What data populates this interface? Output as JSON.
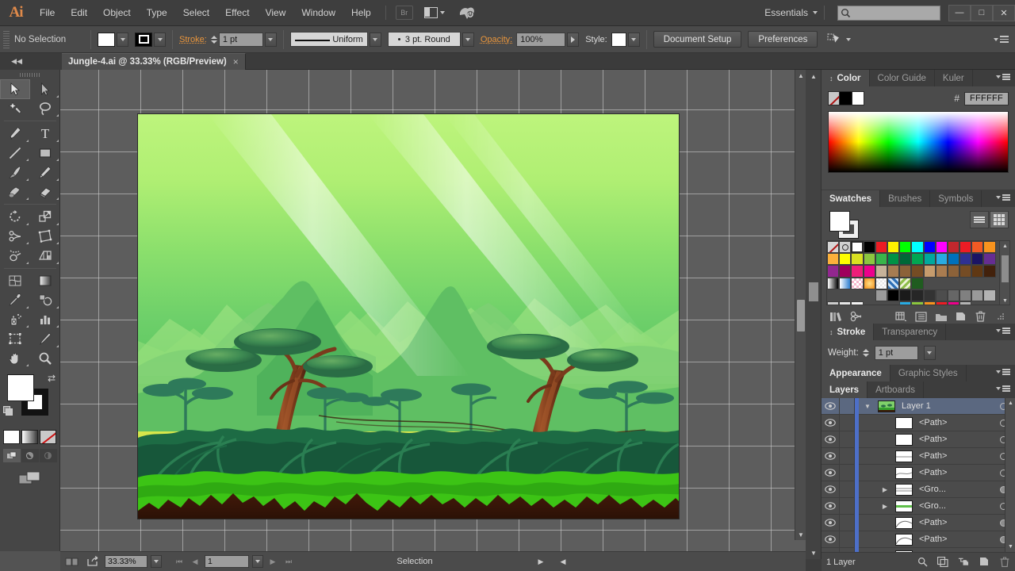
{
  "app": {
    "logo": "Ai",
    "menus": [
      "File",
      "Edit",
      "Object",
      "Type",
      "Select",
      "Effect",
      "View",
      "Window",
      "Help"
    ],
    "bridge_label": "Br",
    "workspace": "Essentials",
    "search_placeholder": "",
    "search_value": "",
    "window_buttons": {
      "minimize": "—",
      "maximize": "□",
      "close": "✕"
    }
  },
  "control_bar": {
    "selection_label": "No Selection",
    "fill_color": "#FFFFFF",
    "stroke_color": "#000000",
    "stroke_label": "Stroke:",
    "stroke_weight": "1 pt",
    "profile_label": "Uniform",
    "brush_label": "3 pt. Round",
    "opacity_label": "Opacity:",
    "opacity_value": "100%",
    "style_label": "Style:",
    "document_setup": "Document Setup",
    "preferences": "Preferences"
  },
  "document": {
    "tab_title": "Jungle-4.ai @ 33.33% (RGB/Preview)",
    "close_glyph": "×"
  },
  "toolbox": {
    "tools": [
      {
        "name": "selection-tool",
        "active": true
      },
      {
        "name": "direct-selection-tool",
        "active": false
      },
      {
        "name": "magic-wand-tool",
        "active": false
      },
      {
        "name": "lasso-tool",
        "active": false
      },
      {
        "name": "pen-tool",
        "active": false
      },
      {
        "name": "type-tool",
        "active": false
      },
      {
        "name": "line-segment-tool",
        "active": false
      },
      {
        "name": "rectangle-tool",
        "active": false
      },
      {
        "name": "paintbrush-tool",
        "active": false
      },
      {
        "name": "pencil-tool",
        "active": false
      },
      {
        "name": "blob-brush-tool",
        "active": false
      },
      {
        "name": "eraser-tool",
        "active": false
      },
      {
        "name": "rotate-tool",
        "active": false
      },
      {
        "name": "scale-tool",
        "active": false
      },
      {
        "name": "width-tool",
        "active": false
      },
      {
        "name": "free-transform-tool",
        "active": false
      },
      {
        "name": "shape-builder-tool",
        "active": false
      },
      {
        "name": "perspective-grid-tool",
        "active": false
      },
      {
        "name": "mesh-tool",
        "active": false
      },
      {
        "name": "gradient-tool",
        "active": false
      },
      {
        "name": "eyedropper-tool",
        "active": false
      },
      {
        "name": "blend-tool",
        "active": false
      },
      {
        "name": "symbol-sprayer-tool",
        "active": false
      },
      {
        "name": "column-graph-tool",
        "active": false
      },
      {
        "name": "artboard-tool",
        "active": false
      },
      {
        "name": "slice-tool",
        "active": false
      },
      {
        "name": "hand-tool",
        "active": false
      },
      {
        "name": "zoom-tool",
        "active": false
      }
    ],
    "fill_color": "#FFFFFF",
    "stroke_color": "#FFFFFF",
    "mode_buttons": [
      "color-fill",
      "gradient-fill",
      "none-fill"
    ],
    "draw_modes": [
      "draw-normal",
      "draw-behind",
      "draw-inside"
    ],
    "screen_mode": "change-screen-mode"
  },
  "color_panel": {
    "tabs": [
      "Color",
      "Color Guide",
      "Kuler"
    ],
    "active_tab": "Color",
    "hash_label": "#",
    "hex_value": "FFFFFF"
  },
  "swatches_panel": {
    "tabs": [
      "Swatches",
      "Brushes",
      "Symbols"
    ],
    "active_tab": "Swatches",
    "fill_color": "#FFFFFF",
    "rows": [
      [
        "none",
        "#8a8a8a",
        "#ffffff",
        "#000000",
        "#ec1c24",
        "#fff200",
        "#00ff00",
        "#00ffff",
        "#0000ff",
        "#ff00ff",
        "#c1272d",
        "#ed1c24",
        "#f15a24",
        "#f7931e",
        "#fbb03b"
      ],
      [
        "#ffff00",
        "#d9e021",
        "#8cc63f",
        "#39b54a",
        "#009245",
        "#006837",
        "#00a651",
        "#00a99d",
        "#29abe2",
        "#0071bc",
        "#2e3192",
        "#1b1464",
        "#662d91",
        "#92278f",
        "#9e005d"
      ],
      [
        "#ed1e79",
        "#ec008c",
        "#c7b299",
        "#a67c52",
        "#8c6239",
        "#754c24",
        "#c69c6d",
        "#a97c50",
        "#8c6239",
        "#754c24",
        "#603813",
        "#42210b",
        "gradient-bw",
        "gradient-blue",
        "pattern-pink"
      ],
      [
        "radial-orange",
        "pattern-check",
        "pattern-blue",
        "pattern-leaf",
        "#1f5c1f",
        "",
        "",
        "",
        "",
        "",
        "",
        "",
        "",
        "",
        ""
      ],
      [
        "folder",
        "#000000",
        "#1a1a1a",
        "#262626",
        "#333333",
        "#4d4d4d",
        "#666666",
        "#808080",
        "#999999",
        "#b3b3b3",
        "#cccccc",
        "#e6e6e6",
        "#f2f2f2",
        "",
        ""
      ],
      [
        "",
        "#29abe2",
        "#8cc63f",
        "#f7931e",
        "#ed1c24",
        "#ec008c",
        "#b3b3b3",
        "",
        "",
        "",
        "",
        "",
        "",
        "",
        ""
      ]
    ]
  },
  "stroke_panel": {
    "tabs": [
      "Stroke",
      "Transparency"
    ],
    "active_tab": "Stroke",
    "weight_label": "Weight:",
    "weight_value": "1 pt"
  },
  "appearance_panel": {
    "tabs": [
      "Appearance",
      "Graphic Styles"
    ],
    "active_tab": "Appearance"
  },
  "layers_panel": {
    "tabs": [
      "Layers",
      "Artboards"
    ],
    "active_tab": "Layers",
    "rows": [
      {
        "name": "Layer 1",
        "type": "layer",
        "selected": true,
        "expanded": true,
        "target_filled": false,
        "thumb": "artwork"
      },
      {
        "name": "<Path>",
        "type": "path",
        "selected": false,
        "target_filled": false,
        "thumb": "blank"
      },
      {
        "name": "<Path>",
        "type": "path",
        "selected": false,
        "target_filled": false,
        "thumb": "blank"
      },
      {
        "name": "<Path>",
        "type": "path",
        "selected": false,
        "target_filled": false,
        "thumb": "line"
      },
      {
        "name": "<Path>",
        "type": "path",
        "selected": false,
        "target_filled": false,
        "thumb": "curve"
      },
      {
        "name": "<Gro...",
        "type": "group",
        "selected": false,
        "target_filled": true,
        "thumb": "lines"
      },
      {
        "name": "<Gro...",
        "type": "group",
        "selected": false,
        "target_filled": false,
        "thumb": "green-line"
      },
      {
        "name": "<Path>",
        "type": "path",
        "selected": false,
        "target_filled": true,
        "thumb": "hill"
      },
      {
        "name": "<Path>",
        "type": "path",
        "selected": false,
        "target_filled": true,
        "thumb": "hill"
      },
      {
        "name": "<Path>",
        "type": "path",
        "selected": false,
        "target_filled": true,
        "thumb": "hill"
      }
    ],
    "footer_label": "1 Layer",
    "footer_icons": [
      "locate-object",
      "make-clipping-mask",
      "make-sublayer",
      "create-new-layer",
      "delete-selection"
    ]
  },
  "status_bar": {
    "zoom_value": "33.33%",
    "page_value": "1",
    "status_text": "Selection"
  },
  "artwork": {
    "title": "Jungle scene illustration",
    "colors": {
      "sky_top": "#bdf47c",
      "sky_mid": "#6ed06a",
      "sky_low": "#d9e64b",
      "mountain_far": "#9ae07e",
      "mountain_mid": "#7fd176",
      "mountain_near": "#58b85e",
      "bush_dark": "#1f6b45",
      "bush_darker": "#17573a",
      "grass_bright": "#3cc415",
      "grass_mid": "#2faa12",
      "soil_dark": "#3b1a08",
      "trunk": "#7a3a1c",
      "trunk_light": "#a2562c",
      "canopy": "#2c7a4b",
      "canopy_light": "#4e9d5c",
      "ray": "#ffffff"
    }
  }
}
